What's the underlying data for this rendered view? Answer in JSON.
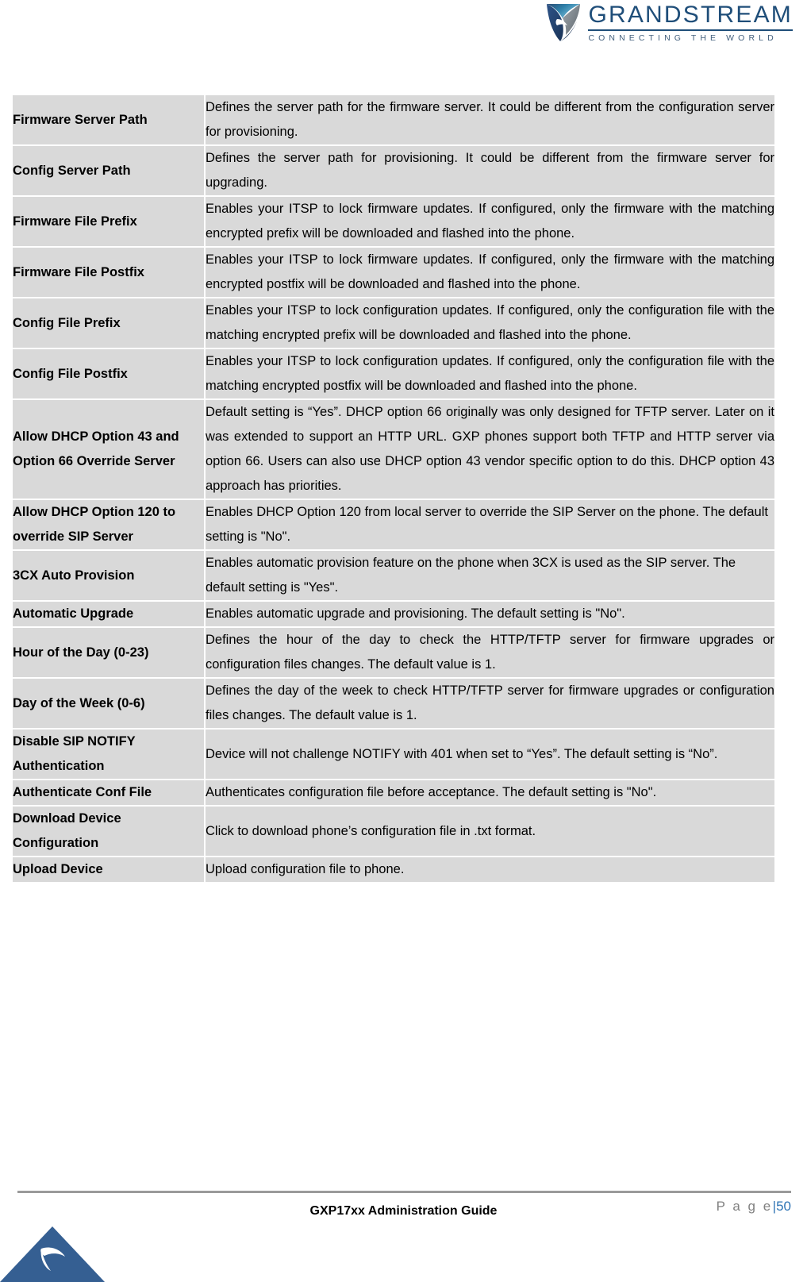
{
  "header": {
    "logo": {
      "icon": "grandstream-swoosh-logo",
      "brand_name": "GRANDSTREAM",
      "tagline": "CONNECTING THE WORLD",
      "brand_color": "#1f4e79"
    }
  },
  "table": {
    "rows": [
      {
        "label": "Firmware Server Path",
        "description": "Defines the server path for the firmware server. It could be different from the configuration server for provisioning."
      },
      {
        "label": "Config Server Path",
        "description": "Defines the server path for provisioning. It could be different from the firmware server for upgrading."
      },
      {
        "label": "Firmware File Prefix",
        "description": "Enables your ITSP to lock firmware updates. If configured, only the firmware with the matching encrypted prefix will be downloaded and flashed into the phone."
      },
      {
        "label": "Firmware File Postfix",
        "description": "Enables your ITSP to lock firmware updates. If configured, only the firmware with the matching encrypted postfix will be downloaded and flashed into the phone."
      },
      {
        "label": "Config File Prefix",
        "description": "Enables your ITSP to lock configuration updates. If configured, only the configuration file with the matching encrypted prefix will be downloaded and flashed into the phone."
      },
      {
        "label": "Config File Postfix",
        "description": "Enables your ITSP to lock configuration updates. If configured, only the configuration file with the matching encrypted postfix will be downloaded and flashed into the phone."
      },
      {
        "label": "Allow DHCP Option 43 and Option 66 Override Server",
        "description": "Default setting is “Yes”. DHCP option 66 originally was only designed for TFTP server. Later on it was extended to support an HTTP URL. GXP phones support both TFTP and HTTP server via option 66. Users can also use DHCP option 43 vendor specific option to do this. DHCP option 43 approach has priorities."
      },
      {
        "label": "Allow DHCP Option 120 to override SIP Server",
        "description": "Enables DHCP Option 120 from local server to override the SIP Server on the phone. The default setting is \"No\"."
      },
      {
        "label": "3CX Auto Provision",
        "description": "Enables automatic provision feature on the phone when 3CX is used as the SIP server. The default setting is \"Yes\"."
      },
      {
        "label": "Automatic Upgrade",
        "description": "Enables automatic upgrade and provisioning. The default setting is \"No\"."
      },
      {
        "label": "Hour of the Day (0-23)",
        "description": "Defines the hour of the day to check the HTTP/TFTP server for firmware upgrades or configuration files changes. The default value is 1."
      },
      {
        "label": "Day of the Week (0-6)",
        "description": "Defines the day of the week to check HTTP/TFTP server for firmware upgrades or configuration files changes. The default value is 1."
      },
      {
        "label": "Disable SIP NOTIFY Authentication",
        "description": "Device will not challenge NOTIFY with 401 when set to “Yes”. The default setting is “No”."
      },
      {
        "label": "Authenticate Conf File",
        "description": "Authenticates configuration file before acceptance. The default setting is \"No\"."
      },
      {
        "label": "Download Device Configuration",
        "description": "Click to download phone’s configuration file in .txt format."
      },
      {
        "label": "Upload Device",
        "description": "Upload configuration file to phone."
      }
    ]
  },
  "footer": {
    "document_title": "GXP17xx Administration Guide",
    "page_word": "P a g e",
    "page_separator": "|",
    "page_number": "50",
    "badge_icon": "grandstream-triangle-badge",
    "accent_color": "#2e74b5"
  }
}
